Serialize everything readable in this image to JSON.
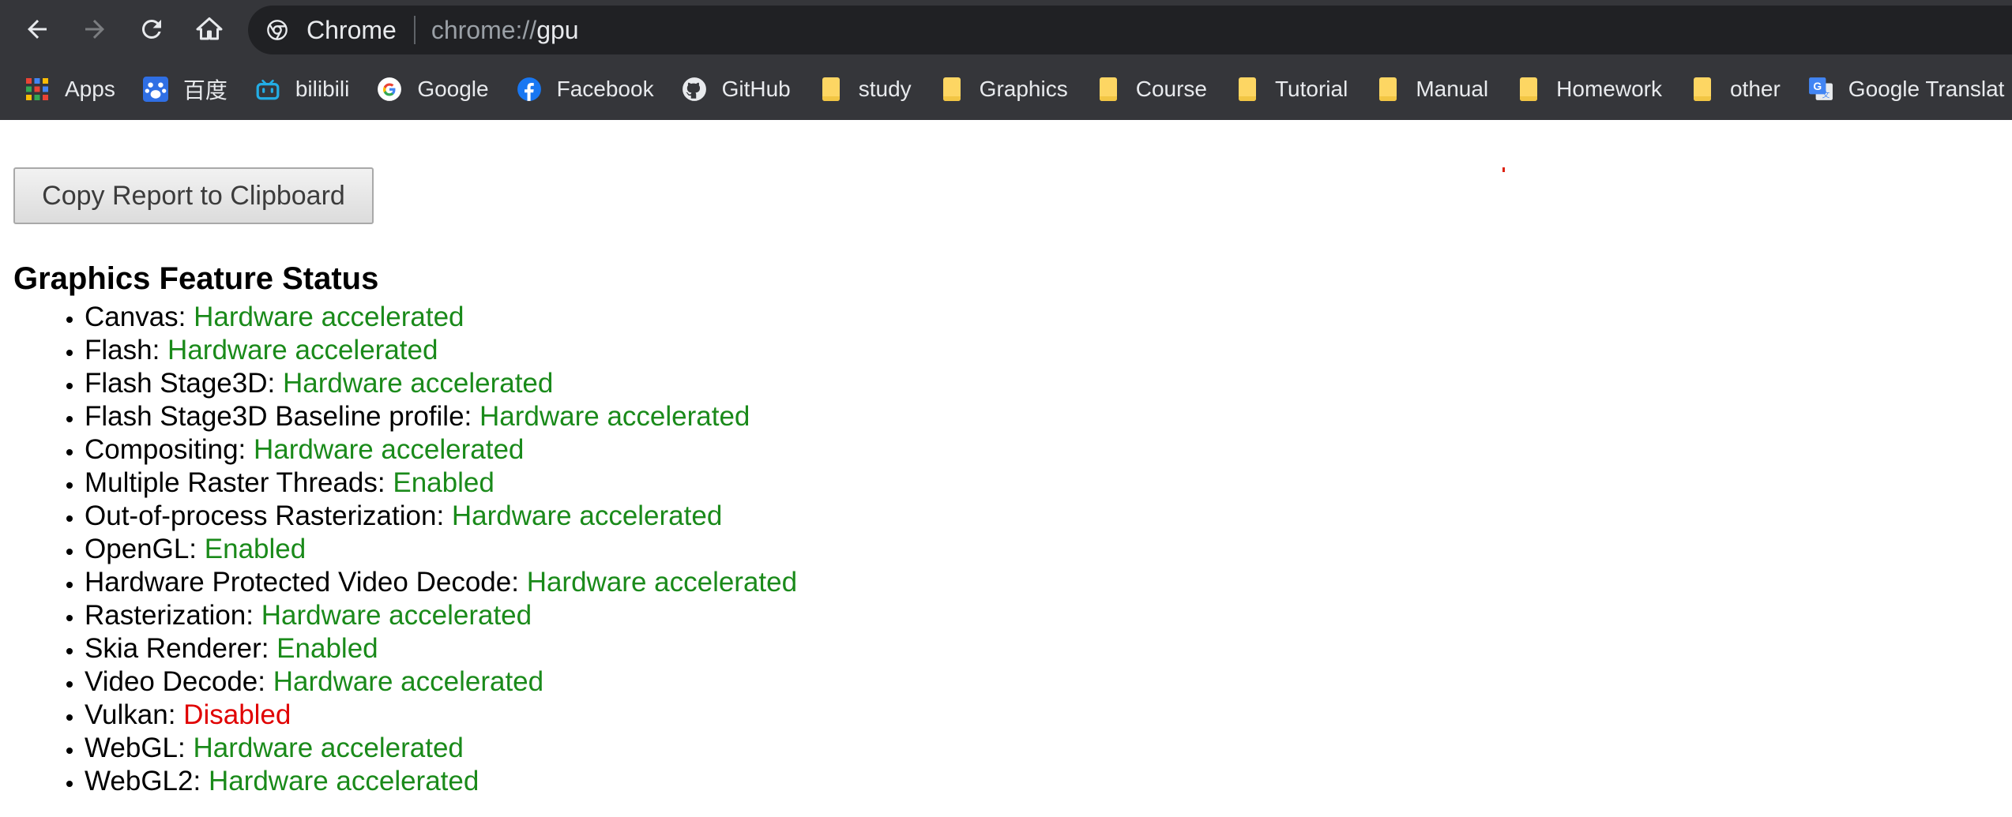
{
  "browser": {
    "nav": {
      "back_icon": "arrow-left-icon",
      "forward_icon": "arrow-right-icon",
      "reload_icon": "reload-icon",
      "home_icon": "home-icon"
    },
    "omnibox": {
      "chip_label": "Chrome",
      "url_scheme": "chrome://",
      "url_path": "gpu"
    },
    "bookmarks": [
      {
        "label": "Apps",
        "icon": "apps-grid-icon"
      },
      {
        "label": "百度",
        "icon": "baidu-icon"
      },
      {
        "label": "bilibili",
        "icon": "bilibili-icon"
      },
      {
        "label": "Google",
        "icon": "google-icon"
      },
      {
        "label": "Facebook",
        "icon": "facebook-icon"
      },
      {
        "label": "GitHub",
        "icon": "github-icon"
      },
      {
        "label": "study",
        "icon": "folder-icon"
      },
      {
        "label": "Graphics",
        "icon": "folder-icon"
      },
      {
        "label": "Course",
        "icon": "folder-icon"
      },
      {
        "label": "Tutorial",
        "icon": "folder-icon"
      },
      {
        "label": "Manual",
        "icon": "folder-icon"
      },
      {
        "label": "Homework",
        "icon": "folder-icon"
      },
      {
        "label": "other",
        "icon": "folder-icon"
      },
      {
        "label": "Google Translat",
        "icon": "google-translate-icon"
      }
    ]
  },
  "page": {
    "copy_button_label": "Copy Report to Clipboard",
    "section_title": "Graphics Feature Status",
    "features": [
      {
        "name": "Canvas: ",
        "status": "Hardware accelerated",
        "color": "#1a8a1a"
      },
      {
        "name": "Flash: ",
        "status": "Hardware accelerated",
        "color": "#1a8a1a"
      },
      {
        "name": "Flash Stage3D: ",
        "status": "Hardware accelerated",
        "color": "#1a8a1a"
      },
      {
        "name": "Flash Stage3D Baseline profile: ",
        "status": "Hardware accelerated",
        "color": "#1a8a1a"
      },
      {
        "name": "Compositing: ",
        "status": "Hardware accelerated",
        "color": "#1a8a1a"
      },
      {
        "name": "Multiple Raster Threads: ",
        "status": "Enabled",
        "color": "#1a8a1a"
      },
      {
        "name": "Out-of-process Rasterization: ",
        "status": "Hardware accelerated",
        "color": "#1a8a1a"
      },
      {
        "name": "OpenGL: ",
        "status": "Enabled",
        "color": "#1a8a1a"
      },
      {
        "name": "Hardware Protected Video Decode: ",
        "status": "Hardware accelerated",
        "color": "#1a8a1a"
      },
      {
        "name": "Rasterization: ",
        "status": "Hardware accelerated",
        "color": "#1a8a1a"
      },
      {
        "name": "Skia Renderer: ",
        "status": "Enabled",
        "color": "#1a8a1a"
      },
      {
        "name": "Video Decode: ",
        "status": "Hardware accelerated",
        "color": "#1a8a1a"
      },
      {
        "name": "Vulkan: ",
        "status": "Disabled",
        "color": "#e00000"
      },
      {
        "name": "WebGL: ",
        "status": "Hardware accelerated",
        "color": "#1a8a1a"
      },
      {
        "name": "WebGL2: ",
        "status": "Hardware accelerated",
        "color": "#1a8a1a"
      }
    ]
  }
}
